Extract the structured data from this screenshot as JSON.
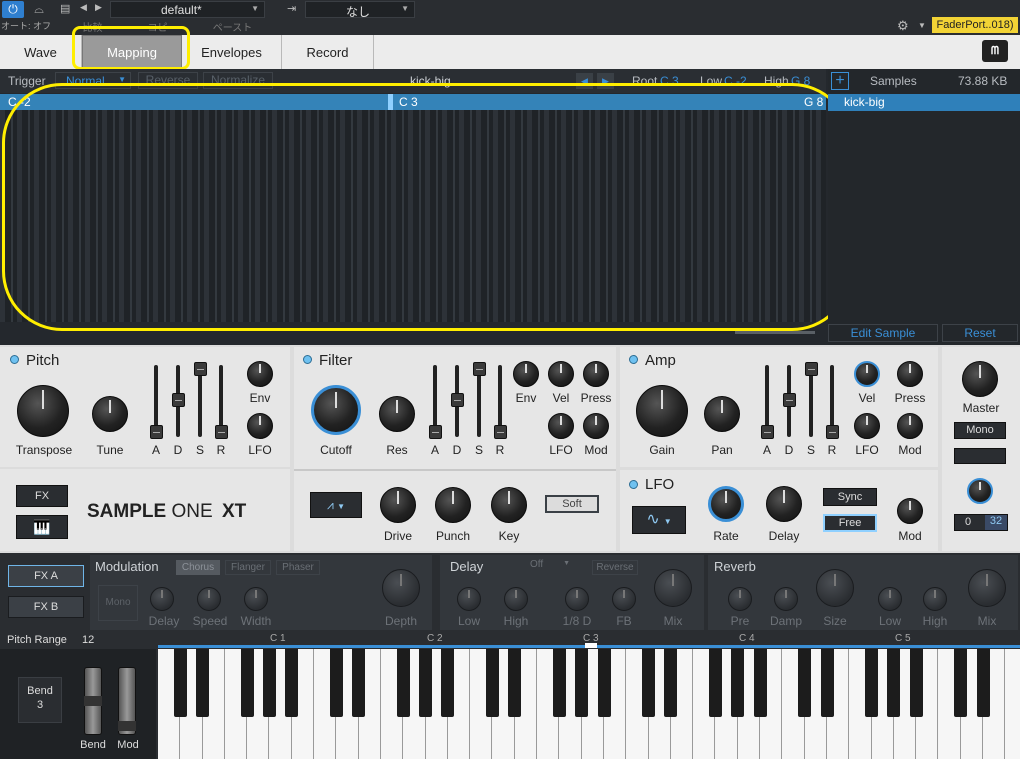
{
  "topbar": {
    "auto_label": "オート: オフ",
    "preset_name": "default*",
    "compare_label": "比較",
    "copy_label": "コピー",
    "paste_label": "ペースト",
    "sidechain_value": "なし",
    "device_label": "FaderPort..018)"
  },
  "tabs": {
    "wave": "Wave",
    "mapping": "Mapping",
    "envelopes": "Envelopes",
    "record": "Record"
  },
  "mapping": {
    "trigger_label": "Trigger",
    "trigger_value": "Normal",
    "reverse_label": "Reverse",
    "normalize_label": "Normalize",
    "sample_name": "kick-big",
    "root_label": "Root",
    "root_value": "C 3",
    "low_label": "Low",
    "low_value": "C -2",
    "high_label": "High",
    "high_value": "G 8",
    "zone_left": "C -2",
    "zone_center": "C 3",
    "zone_right": "G 8"
  },
  "samples": {
    "header": "Samples",
    "size": "73.88 KB",
    "items": [
      "kick-big"
    ],
    "edit_button": "Edit Sample",
    "reset_button": "Reset"
  },
  "pitch": {
    "title": "Pitch",
    "transpose": "Transpose",
    "tune": "Tune",
    "env": "Env",
    "lfo": "LFO",
    "a": "A",
    "d": "D",
    "s": "S",
    "r": "R"
  },
  "filter": {
    "title": "Filter",
    "cutoff": "Cutoff",
    "res": "Res",
    "env": "Env",
    "vel": "Vel",
    "press": "Press",
    "lfo": "LFO",
    "mod": "Mod",
    "a": "A",
    "d": "D",
    "s": "S",
    "r": "R",
    "drive": "Drive",
    "punch": "Punch",
    "key": "Key",
    "soft": "Soft"
  },
  "amp": {
    "title": "Amp",
    "gain": "Gain",
    "pan": "Pan",
    "vel": "Vel",
    "press": "Press",
    "lfo": "LFO",
    "mod": "Mod",
    "a": "A",
    "d": "D",
    "s": "S",
    "r": "R"
  },
  "lfo": {
    "title": "LFO",
    "rate": "Rate",
    "delay": "Delay",
    "sync": "Sync",
    "free": "Free",
    "mod": "Mod"
  },
  "master": {
    "label": "Master",
    "mono": "Mono",
    "voices_min": "0",
    "voices_max": "32"
  },
  "brand": {
    "fx": "FX",
    "sample": "SAMPLE",
    "one": "ONE",
    "xt": "XT"
  },
  "fx": {
    "fxa": "FX A",
    "fxb": "FX B",
    "modulation": {
      "title": "Modulation",
      "chorus": "Chorus",
      "flanger": "Flanger",
      "phaser": "Phaser",
      "mono": "Mono",
      "delay": "Delay",
      "speed": "Speed",
      "width": "Width",
      "depth": "Depth"
    },
    "delay": {
      "title": "Delay",
      "off": "Off",
      "reverse": "Reverse",
      "low": "Low",
      "high": "High",
      "beat": "1/8 D",
      "fb": "FB",
      "mix": "Mix"
    },
    "reverb": {
      "title": "Reverb",
      "pre": "Pre",
      "damp": "Damp",
      "size": "Size",
      "low": "Low",
      "high": "High",
      "mix": "Mix"
    }
  },
  "keyboard": {
    "pitch_range_label": "Pitch Range",
    "pitch_range_value": "12",
    "octaves": [
      "C 1",
      "C 2",
      "C 3",
      "C 4",
      "C 5"
    ],
    "bend_label": "Bend",
    "bend_value": "3",
    "bend": "Bend",
    "mod": "Mod"
  },
  "colors": {
    "accent": "#3a8fd6",
    "highlight": "#ffee00",
    "panel": "#e6e6e6",
    "dark": "#24282d"
  }
}
